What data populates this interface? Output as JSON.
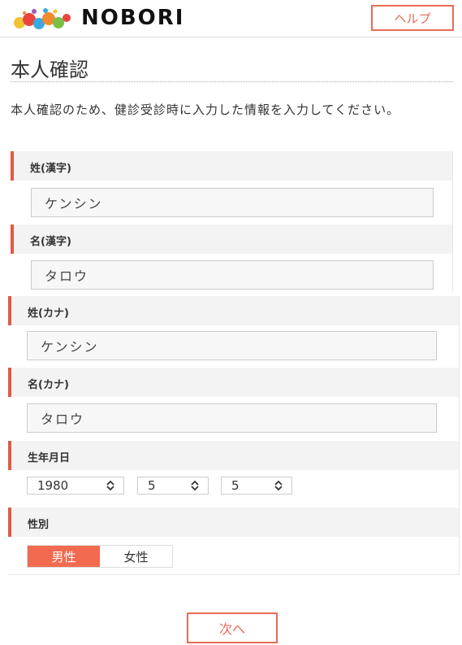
{
  "header": {
    "brand": "NOBORI",
    "help_label": "ヘルプ"
  },
  "page": {
    "title": "本人確認",
    "intro": "本人確認のため、健診受診時に入力した情報を入力してください。"
  },
  "form": {
    "last_name_kanji": {
      "label": "姓(漢字)",
      "value": "ケンシン"
    },
    "first_name_kanji": {
      "label": "名(漢字)",
      "value": "タロウ"
    },
    "last_name_kana": {
      "label": "姓(カナ)",
      "value": "ケンシン"
    },
    "first_name_kana": {
      "label": "名(カナ)",
      "value": "タロウ"
    },
    "birthdate": {
      "label": "生年月日",
      "year": "1980",
      "month": "5",
      "day": "5"
    },
    "gender": {
      "label": "性別",
      "options": [
        "男性",
        "女性"
      ],
      "selected": "男性"
    }
  },
  "footer": {
    "next_label": "次へ"
  },
  "colors": {
    "accent": "#e05a45",
    "active": "#f26a4f"
  }
}
